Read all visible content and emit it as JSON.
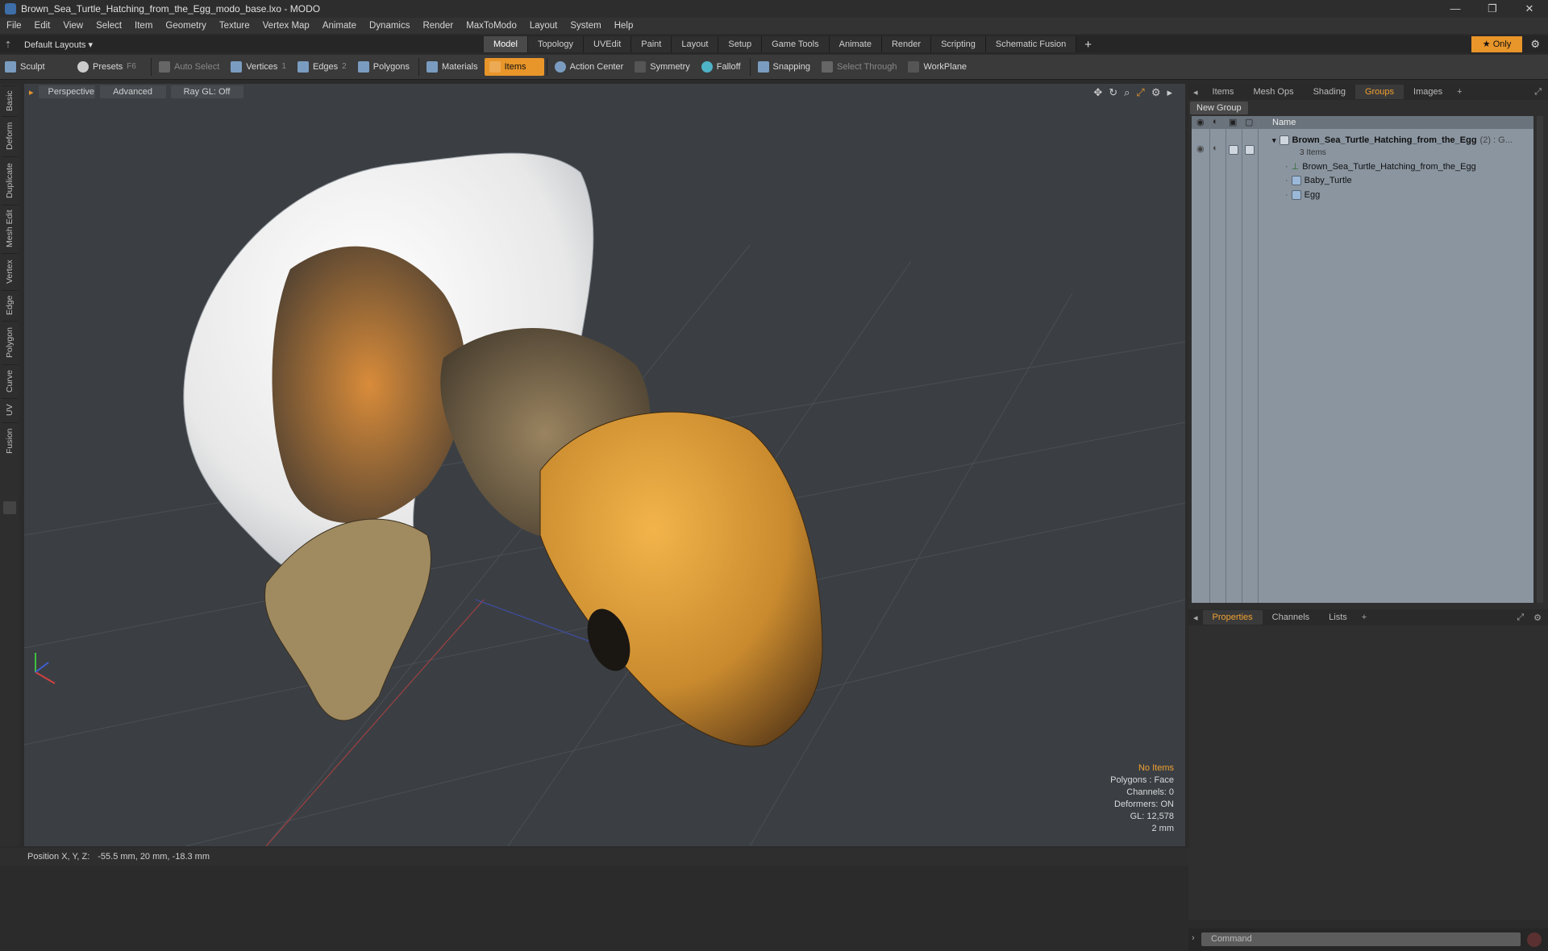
{
  "window": {
    "title": "Brown_Sea_Turtle_Hatching_from_the_Egg_modo_base.lxo - MODO",
    "controls": [
      "—",
      "❐",
      "✕"
    ]
  },
  "menu": [
    "File",
    "Edit",
    "View",
    "Select",
    "Item",
    "Geometry",
    "Texture",
    "Vertex Map",
    "Animate",
    "Dynamics",
    "Render",
    "MaxToModo",
    "Layout",
    "System",
    "Help"
  ],
  "layouts": {
    "preset": "Default Layouts ▾",
    "tabs": [
      "Model",
      "Topology",
      "UVEdit",
      "Paint",
      "Layout",
      "Setup",
      "Game Tools",
      "Animate",
      "Render",
      "Scripting",
      "Schematic Fusion"
    ],
    "active": "Model",
    "add": "+",
    "only": "★  Only",
    "gear": "⚙"
  },
  "toolbar": {
    "sculpt": "Sculpt",
    "presets": "Presets",
    "presets_key": "F6",
    "auto_select": "Auto Select",
    "vertices": "Vertices",
    "vertices_count": "1",
    "edges": "Edges",
    "edges_count": "2",
    "polygons": "Polygons",
    "materials": "Materials",
    "items": "Items",
    "action_center": "Action Center",
    "symmetry": "Symmetry",
    "falloff": "Falloff",
    "snapping": "Snapping",
    "select_through": "Select Through",
    "workplane": "WorkPlane"
  },
  "left_tabs": [
    "Basic",
    "Deform",
    "Duplicate",
    "Mesh Edit",
    "Vertex",
    "Edge",
    "Polygon",
    "Curve",
    "UV",
    "Fusion"
  ],
  "viewport": {
    "view": "Perspective",
    "shading": "Advanced",
    "raygl": "Ray GL: Off",
    "hud": {
      "title": "No Items",
      "lines": [
        "Polygons : Face",
        "Channels: 0",
        "Deformers: ON",
        "GL: 12,578",
        "2 mm"
      ]
    }
  },
  "status": {
    "label": "Position X, Y, Z:",
    "value": "-55.5 mm, 20 mm, -18.3 mm"
  },
  "right_panel": {
    "tabs": [
      "Items",
      "Mesh Ops",
      "Shading",
      "Groups",
      "Images"
    ],
    "active_tab": "Groups",
    "add_tab": "+",
    "new_group": "New Group",
    "name_header": "Name",
    "group": {
      "name": "Brown_Sea_Turtle_Hatching_from_the_Egg",
      "suffix": "(2) : G...",
      "count": "3 Items",
      "children": [
        "Brown_Sea_Turtle_Hatching_from_the_Egg",
        "Baby_Turtle",
        "Egg"
      ]
    },
    "lower_tabs": [
      "Properties",
      "Channels",
      "Lists"
    ],
    "lower_active": "Properties",
    "command_placeholder": "Command"
  },
  "colors": {
    "accent": "#e8952a",
    "viewport_bg": "#3b3f44",
    "groups_bg": "#8a95a0"
  }
}
